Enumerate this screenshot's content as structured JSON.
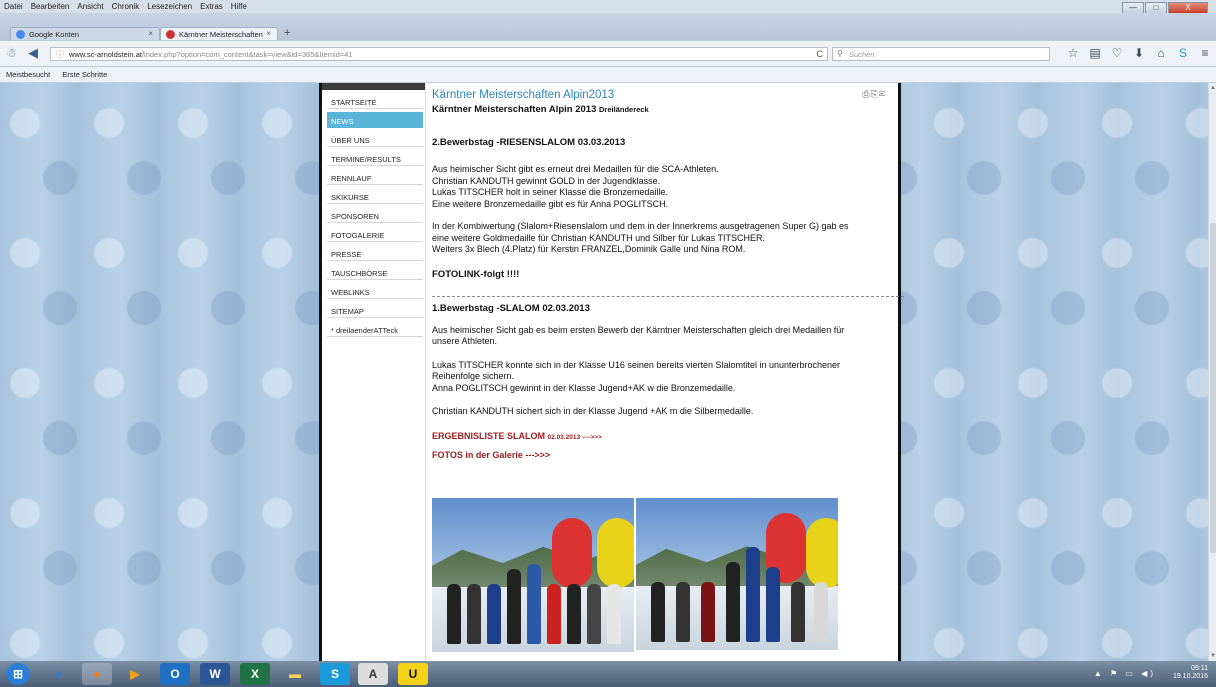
{
  "menubar": [
    "Datei",
    "Bearbeiten",
    "Ansicht",
    "Chronik",
    "Lesezeichen",
    "Extras",
    "Hilfe"
  ],
  "window_controls": {
    "minimize": "—",
    "maximize": "□",
    "close": "X"
  },
  "tabs": [
    {
      "label": "Google Konten",
      "close": "×",
      "icon": "google-icon"
    },
    {
      "label": "Kärntner Meisterschaften A...",
      "close": "×",
      "icon": "site-icon"
    }
  ],
  "newtab_label": "+",
  "nav": {
    "url_host": "www.sc-arnoldstein.at",
    "url_path": "/index.php?option=com_content&task=view&id=365&Itemid=41",
    "search_placeholder": "Suchen",
    "reload": "C"
  },
  "bookmarks": [
    "Meistbesucht",
    "Erste Schritte"
  ],
  "sidebar": {
    "items": [
      {
        "label": "STARTSEITE"
      },
      {
        "label": "NEWS",
        "active": true
      },
      {
        "label": "ÜBER UNS"
      },
      {
        "label": "TERMINE/RESULTS"
      },
      {
        "label": "RENNLAUF"
      },
      {
        "label": "SKIKURSE"
      },
      {
        "label": "SPONSOREN"
      },
      {
        "label": "FOTOGALERIE"
      },
      {
        "label": "PRESSE"
      },
      {
        "label": "TAUSCHBÖRSE"
      },
      {
        "label": "WEBLINKS"
      },
      {
        "label": "SITEMAP"
      },
      {
        "label": "* dreilaenderATTeck"
      }
    ]
  },
  "article": {
    "title": "Kärntner Meisterschaften Alpin2013",
    "subtitle": "Kärntner Meisterschaften Alpin 2013",
    "subtitle_small": "Dreiländereck",
    "day2_heading": "2.Bewerbstag -RIESENSLALOM 03.03.2013",
    "day2_p1": [
      "Aus heimischer Sicht gibt es erneut drei Medaillen für die SCA-Athleten.",
      "Christian KANDUTH gewinnt GOLD in der Jugendklasse.",
      "Lukas TITSCHER holt in seiner Klasse die Bronzemedaille.",
      "Eine weitere Bronzemedaille gibt es für Anna POGLITSCH."
    ],
    "day2_p2": [
      "In der Kombiwertung (Slalom+Riesenslalom und dem in der Innerkrems ausgetragenen Super G) gab es",
      "eine weitere Goldmedaille für Christian KANDUTH und Silber für Lukas TITSCHER.",
      "Weiters 3x Blech (4.Platz) für Kerstin FRANZEL,Dominik Galle und Nina ROM."
    ],
    "fotolink": "FOTOLINK-folgt !!!!",
    "day1_heading": "1.Bewerbstag -SLALOM 02.03.2013",
    "day1_p1": [
      "Aus heimischer Sicht gab es beim ersten Bewerb der Kärntner Meisterschaften gleich drei Medaillen für",
      "unsere Athleten."
    ],
    "day1_p2": [
      "Lukas TITSCHER konnte sich in der Klasse U16 seinen bereits vierten Slalomtitel in ununterbrochener",
      "Reihenfolge sichern.",
      "Anna POGLITSCH gewinnt in der Klasse Jugend+AK w die Bronzemedaille."
    ],
    "day1_p3": "Christian KANDUTH sichert sich in der Klasse Jugend +AK m die Silbermedaille.",
    "link1": "ERGEBNISLISTE SLALOM",
    "link1_small": "02.03.2013 ---->>>",
    "link2": "FOTOS in der Galerie --->>>"
  },
  "tray": {
    "time": "09:11",
    "date": "19.10.2016"
  }
}
